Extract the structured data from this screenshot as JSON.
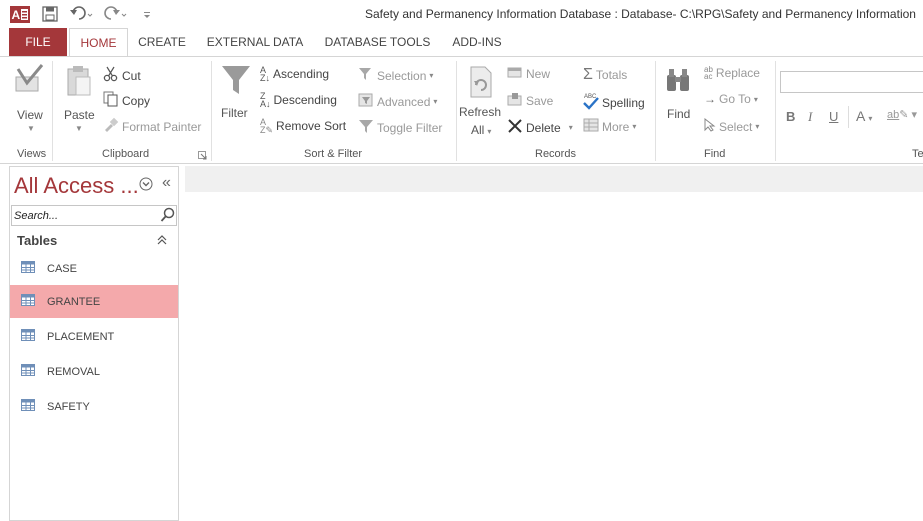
{
  "app": {
    "title": "Safety and Permanency Information Database : Database- C:\\RPG\\Safety and Permanency Information",
    "logo_text": "A",
    "accent": "#a4373a"
  },
  "tabs": [
    {
      "label": "FILE"
    },
    {
      "label": "HOME"
    },
    {
      "label": "CREATE"
    },
    {
      "label": "EXTERNAL DATA"
    },
    {
      "label": "DATABASE TOOLS"
    },
    {
      "label": "ADD-INS"
    }
  ],
  "ribbon": {
    "views": {
      "view": "View",
      "group": "Views"
    },
    "clipboard": {
      "paste": "Paste",
      "cut": "Cut",
      "copy": "Copy",
      "format_painter": "Format Painter",
      "group": "Clipboard"
    },
    "sort_filter": {
      "filter": "Filter",
      "ascending": "Ascending",
      "descending": "Descending",
      "remove_sort": "Remove Sort",
      "selection": "Selection",
      "advanced": "Advanced",
      "toggle_filter": "Toggle Filter",
      "group": "Sort & Filter"
    },
    "records": {
      "refresh": "Refresh",
      "refresh_all": "All",
      "new": "New",
      "save": "Save",
      "delete": "Delete",
      "totals": "Totals",
      "spelling": "Spelling",
      "more": "More",
      "group": "Records"
    },
    "find": {
      "find": "Find",
      "replace": "Replace",
      "goto": "Go To",
      "select": "Select",
      "group": "Find"
    },
    "text": {
      "bold": "B",
      "italic": "I",
      "underline": "U",
      "font_color": "A",
      "group": "Te"
    }
  },
  "nav": {
    "title": "All Access ...",
    "search_placeholder": "Search...",
    "category": "Tables",
    "items": [
      {
        "label": "CASE"
      },
      {
        "label": "GRANTEE"
      },
      {
        "label": "PLACEMENT"
      },
      {
        "label": "REMOVAL"
      },
      {
        "label": "SAFETY"
      }
    ]
  }
}
